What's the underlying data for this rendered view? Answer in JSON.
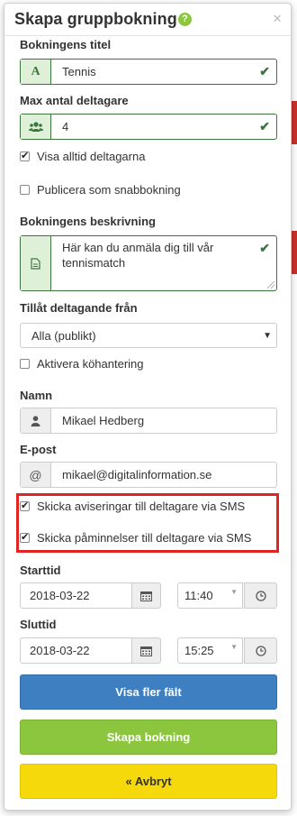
{
  "modal": {
    "title": "Skapa gruppbokning",
    "help_icon": "?",
    "close_icon": "×"
  },
  "fields": {
    "title_label": "Bokningens titel",
    "title_value": "Tennis",
    "title_icon_glyph": "A",
    "max_label": "Max antal deltagare",
    "max_value": "4",
    "show_participants_label": "Visa alltid deltagarna",
    "publish_quick_label": "Publicera som snabbokning",
    "description_label": "Bokningens beskrivning",
    "description_value": "Här kan du anmäla dig till vår tennismatch",
    "allow_from_label": "Tillåt deltagande från",
    "allow_from_value": "Alla (publikt)",
    "queue_label": "Aktivera köhantering",
    "name_label": "Namn",
    "name_value": "Mikael Hedberg",
    "email_label": "E-post",
    "email_icon_glyph": "@",
    "email_value": "mikael@digitalinformation.se",
    "sms_notify_label": "Skicka aviseringar till deltagare via SMS",
    "sms_remind_label": "Skicka påminnelser till deltagare via SMS",
    "start_label": "Starttid",
    "start_date": "2018-03-22",
    "start_time": "11:40",
    "end_label": "Sluttid",
    "end_date": "2018-03-22",
    "end_time": "15:25"
  },
  "checkboxes": {
    "show_participants": true,
    "publish_quick": false,
    "queue": false,
    "sms_notify": true,
    "sms_remind": true
  },
  "buttons": {
    "more_fields": "Visa fler fält",
    "create": "Skapa bokning",
    "cancel": "« Avbryt"
  },
  "colors": {
    "success": "#3c763d",
    "blue": "#3d7fc1",
    "green": "#8cc63f",
    "yellow": "#f5d90a",
    "highlight": "#e02424"
  },
  "icons": [
    "help-icon",
    "close-icon",
    "text-icon",
    "users-icon",
    "check-icon",
    "document-icon",
    "user-icon",
    "at-icon",
    "calendar-icon",
    "clock-icon",
    "caret-down-icon"
  ]
}
